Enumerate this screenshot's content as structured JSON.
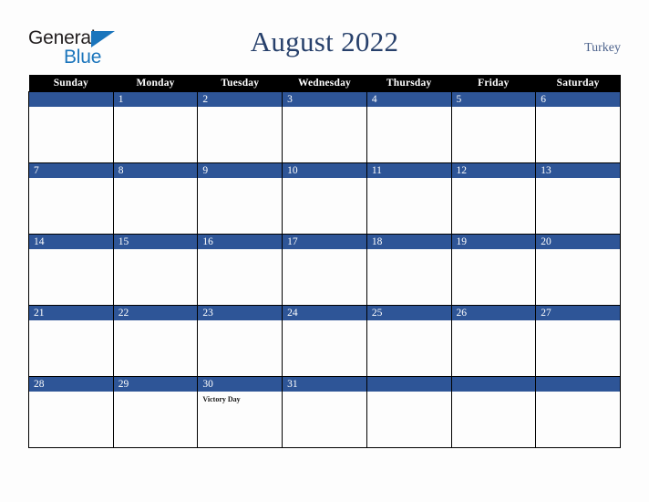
{
  "logo": {
    "text_top": "General",
    "text_bottom": "Blue",
    "triangle_color": "#1b75bc",
    "top_color": "#231f20"
  },
  "header": {
    "title": "August 2022",
    "country": "Turkey",
    "title_color": "#27406b",
    "country_color": "#4c628c"
  },
  "calendar": {
    "header_bg": "#000000",
    "band_bg": "#2e5597",
    "weekdays": [
      "Sunday",
      "Monday",
      "Tuesday",
      "Wednesday",
      "Thursday",
      "Friday",
      "Saturday"
    ],
    "weeks": [
      [
        {
          "day": "",
          "event": ""
        },
        {
          "day": "1",
          "event": ""
        },
        {
          "day": "2",
          "event": ""
        },
        {
          "day": "3",
          "event": ""
        },
        {
          "day": "4",
          "event": ""
        },
        {
          "day": "5",
          "event": ""
        },
        {
          "day": "6",
          "event": ""
        }
      ],
      [
        {
          "day": "7",
          "event": ""
        },
        {
          "day": "8",
          "event": ""
        },
        {
          "day": "9",
          "event": ""
        },
        {
          "day": "10",
          "event": ""
        },
        {
          "day": "11",
          "event": ""
        },
        {
          "day": "12",
          "event": ""
        },
        {
          "day": "13",
          "event": ""
        }
      ],
      [
        {
          "day": "14",
          "event": ""
        },
        {
          "day": "15",
          "event": ""
        },
        {
          "day": "16",
          "event": ""
        },
        {
          "day": "17",
          "event": ""
        },
        {
          "day": "18",
          "event": ""
        },
        {
          "day": "19",
          "event": ""
        },
        {
          "day": "20",
          "event": ""
        }
      ],
      [
        {
          "day": "21",
          "event": ""
        },
        {
          "day": "22",
          "event": ""
        },
        {
          "day": "23",
          "event": ""
        },
        {
          "day": "24",
          "event": ""
        },
        {
          "day": "25",
          "event": ""
        },
        {
          "day": "26",
          "event": ""
        },
        {
          "day": "27",
          "event": ""
        }
      ],
      [
        {
          "day": "28",
          "event": ""
        },
        {
          "day": "29",
          "event": ""
        },
        {
          "day": "30",
          "event": "Victory Day"
        },
        {
          "day": "31",
          "event": ""
        },
        {
          "day": "",
          "event": ""
        },
        {
          "day": "",
          "event": ""
        },
        {
          "day": "",
          "event": ""
        }
      ]
    ]
  }
}
